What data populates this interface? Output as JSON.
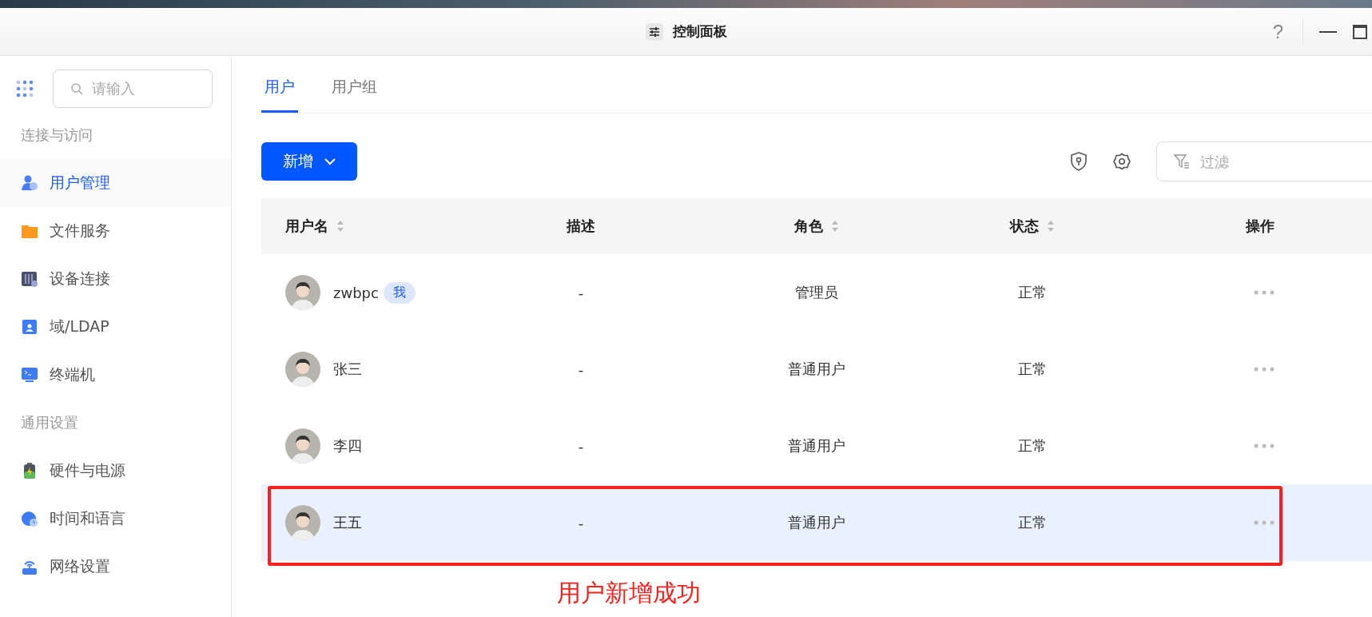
{
  "window": {
    "title": "控制面板",
    "help": "?"
  },
  "sidebar": {
    "search": {
      "placeholder": "请输入"
    },
    "sections": [
      {
        "title": "连接与访问",
        "items": [
          {
            "label": "用户管理",
            "kind": "user",
            "selected": true
          },
          {
            "label": "文件服务",
            "kind": "folder",
            "selected": false
          },
          {
            "label": "设备连接",
            "kind": "device",
            "selected": false
          },
          {
            "label": "域/LDAP",
            "kind": "ldap",
            "selected": false
          },
          {
            "label": "终端机",
            "kind": "terminal",
            "selected": false
          }
        ]
      },
      {
        "title": "通用设置",
        "items": [
          {
            "label": "硬件与电源",
            "kind": "battery",
            "selected": false
          },
          {
            "label": "时间和语言",
            "kind": "clock",
            "selected": false
          },
          {
            "label": "网络设置",
            "kind": "router",
            "selected": false
          }
        ]
      }
    ]
  },
  "tabs": [
    {
      "label": "用户",
      "selected": true
    },
    {
      "label": "用户组",
      "selected": false
    }
  ],
  "toolbar": {
    "add_button": "新增",
    "filter": {
      "placeholder": "过滤"
    }
  },
  "table": {
    "columns": [
      {
        "label": "用户名",
        "sortable": true
      },
      {
        "label": "描述",
        "sortable": false
      },
      {
        "label": "角色",
        "sortable": true
      },
      {
        "label": "状态",
        "sortable": true
      },
      {
        "label": "操作",
        "sortable": false
      }
    ],
    "rows": [
      {
        "name": "zwbpc",
        "badge": "我",
        "description": "-",
        "role": "管理员",
        "status": "正常",
        "selected": false
      },
      {
        "name": "张三",
        "description": "-",
        "role": "普通用户",
        "status": "正常",
        "selected": false
      },
      {
        "name": "李四",
        "description": "-",
        "role": "普通用户",
        "status": "正常",
        "selected": false
      },
      {
        "name": "王五",
        "description": "-",
        "role": "普通用户",
        "status": "正常",
        "selected": true
      }
    ]
  },
  "annotation": {
    "text": "用户新增成功"
  }
}
